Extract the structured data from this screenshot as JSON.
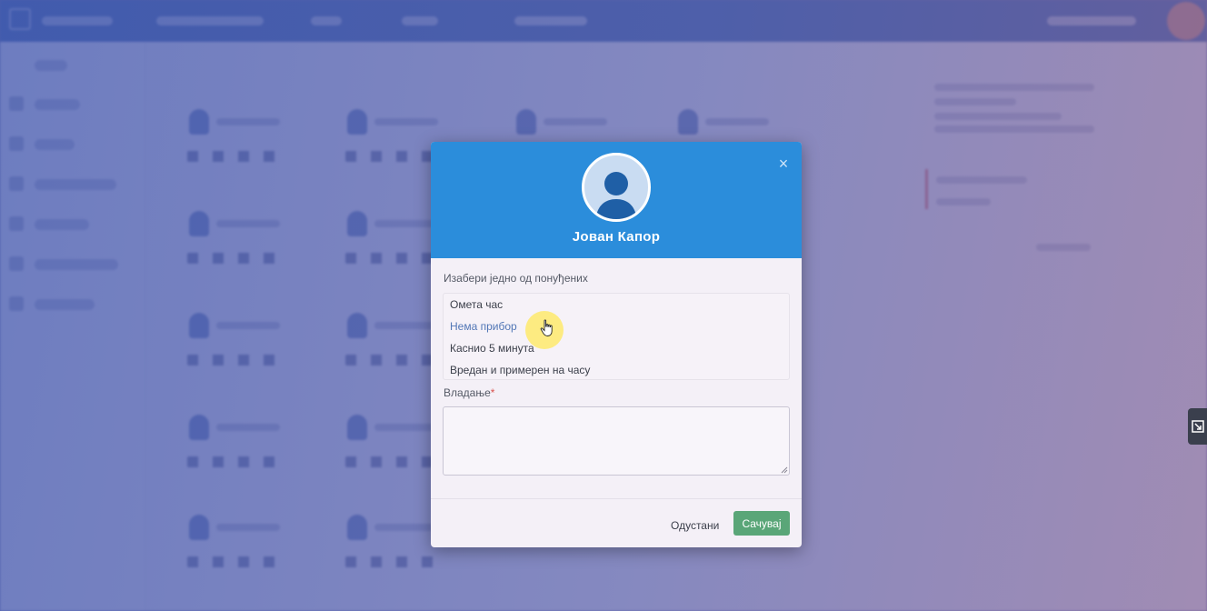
{
  "modal": {
    "student_name": "Јован Капор",
    "close_symbol": "×",
    "choose_label": "Изабери једно од понуђених",
    "options": [
      "Омета час",
      "Нема прибор",
      "Каснио 5 минута",
      "Вредан и примерен на часу"
    ],
    "hovered_option": "Нема прибор",
    "behavior_label": "Владање",
    "required_marker": "*",
    "behavior_value": "",
    "cancel_label": "Одустани",
    "save_label": "Сачувај"
  },
  "icons": {
    "avatar": "user-silhouette-icon",
    "close": "close-icon",
    "cursor": "hand-pointer-icon",
    "side_widget": "resize-icon"
  },
  "colors": {
    "header": "#2b8ddb",
    "save_button": "#5aa678",
    "required": "#d9534f",
    "overlay": "#5c6aa6"
  }
}
